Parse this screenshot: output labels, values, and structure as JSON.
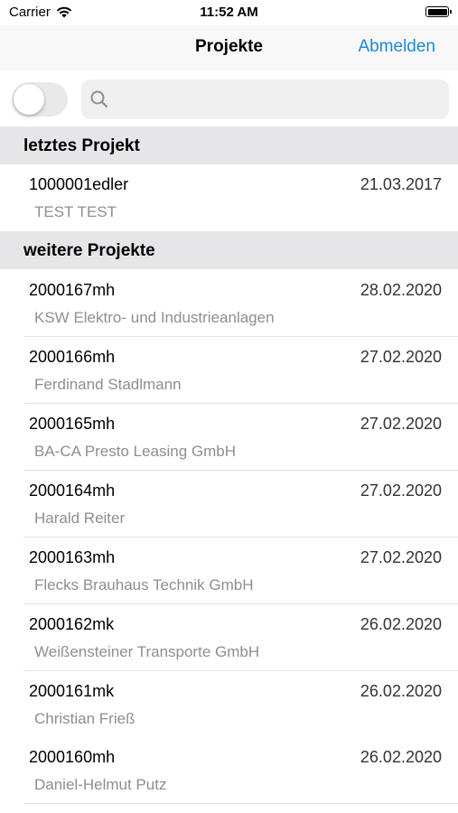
{
  "status_bar": {
    "carrier": "Carrier",
    "time": "11:52 AM"
  },
  "nav": {
    "title": "Projekte",
    "action": "Abmelden",
    "accent_color": "#1e88d6"
  },
  "search": {
    "placeholder": "",
    "value": "",
    "toggle_on": false
  },
  "sections": {
    "last": {
      "title": "letztes Projekt",
      "items": [
        {
          "id": "1000001edler",
          "date": "21.03.2017",
          "name": "TEST TEST"
        }
      ]
    },
    "more": {
      "title": "weitere Projekte",
      "items": [
        {
          "id": "2000167mh",
          "date": "28.02.2020",
          "name": "KSW Elektro- und Industrieanlagen"
        },
        {
          "id": "2000166mh",
          "date": "27.02.2020",
          "name": "Ferdinand Stadlmann"
        },
        {
          "id": "2000165mh",
          "date": "27.02.2020",
          "name": "BA-CA Presto Leasing GmbH"
        },
        {
          "id": "2000164mh",
          "date": "27.02.2020",
          "name": "Harald Reiter"
        },
        {
          "id": "2000163mh",
          "date": "27.02.2020",
          "name": "Flecks Brauhaus Technik GmbH"
        },
        {
          "id": "2000162mk",
          "date": "26.02.2020",
          "name": "Weißensteiner Transporte GmbH"
        },
        {
          "id": "2000161mk",
          "date": "26.02.2020",
          "name": "Christian Frieß"
        },
        {
          "id": "2000160mh",
          "date": "26.02.2020",
          "name": "Daniel-Helmut Putz"
        }
      ]
    }
  }
}
